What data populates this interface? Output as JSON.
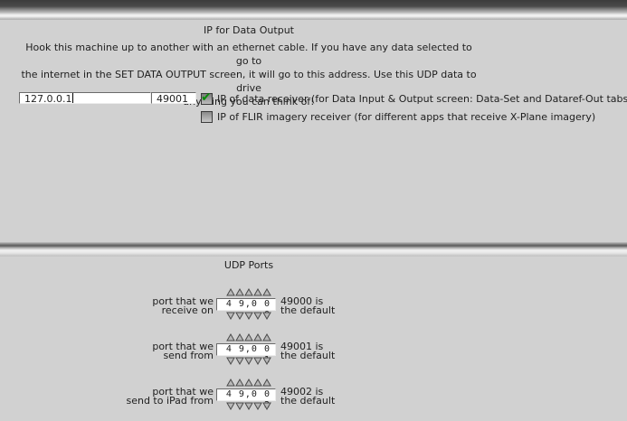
{
  "ip_section": {
    "title": "IP for Data Output",
    "description": "Hook this machine up to another with an ethernet cable. If you have any data selected to go to\nthe internet in the SET DATA OUTPUT screen, it will go to this address. Use this UDP data to drive\nanything you can think of!",
    "ip_value": "127.0.0.1",
    "port_value": "49001",
    "checkbox_data_receiver": {
      "label": "IP of data receiver (for Data Input & Output screen: Data-Set and Dataref-Out tabs)",
      "checked": true
    },
    "checkbox_flir_receiver": {
      "label": "IP of FLIR imagery receiver (for different apps that receive X-Plane imagery)",
      "checked": false
    }
  },
  "udp_section": {
    "title": "UDP Ports",
    "ports": [
      {
        "label": "port that we\nreceive on",
        "value": "4 9,0 0 0",
        "default_note": "49000 is\nthe default"
      },
      {
        "label": "port that we\nsend from",
        "value": "4 9,0 0 1",
        "default_note": "49001 is\nthe default"
      },
      {
        "label": "port that we\nsend to iPad from",
        "value": "4 9,0 0 2",
        "default_note": "49002 is\nthe default"
      }
    ]
  },
  "icons": {
    "check": "check-icon",
    "up": "up-arrow-icon",
    "down": "down-arrow-icon"
  },
  "colors": {
    "background": "#d1d1d1",
    "check": "#0a8a0a"
  }
}
